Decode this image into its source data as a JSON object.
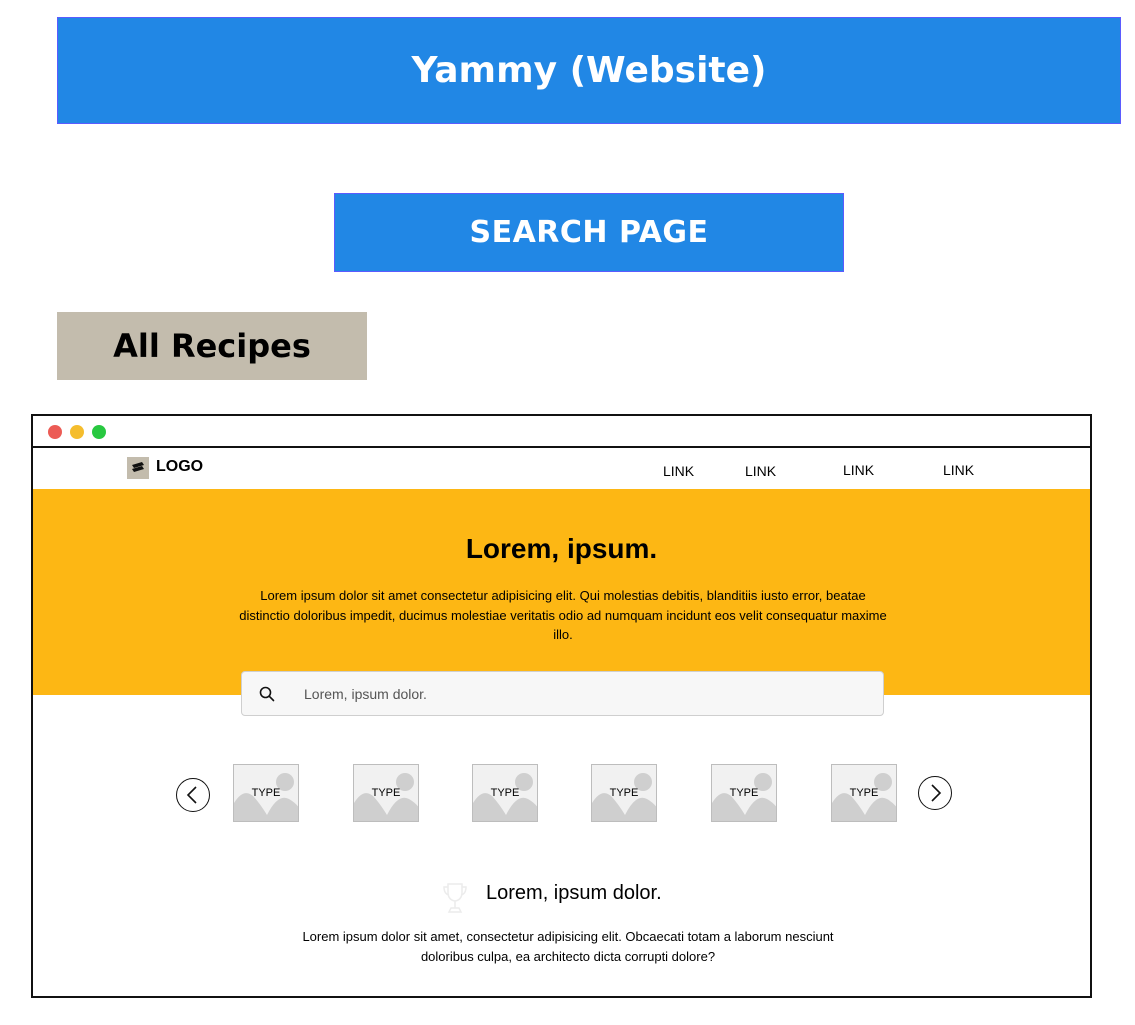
{
  "header": {
    "title": "Yammy (Website)",
    "page_label": "SEARCH PAGE",
    "section_label": "All Recipes"
  },
  "colors": {
    "banner_blue": "#2187e5",
    "section_tan": "#c3bcad",
    "hero_yellow": "#fdb714",
    "mac_red": "#ec5b55",
    "mac_yellow": "#f5bd2d",
    "mac_green": "#28c840"
  },
  "browser": {
    "nav": {
      "logo_text": "LOGO",
      "links": [
        "LINK",
        "LINK",
        "LINK",
        "LINK"
      ]
    },
    "hero": {
      "title": "Lorem, ipsum.",
      "text": "Lorem ipsum dolor sit amet consectetur adipisicing elit. Qui molestias debitis, blanditiis iusto error, beatae distinctio doloribus impedit, ducimus molestiae veritatis odio ad numquam incidunt eos velit consequatur maxime illo.",
      "search_placeholder": "Lorem, ipsum dolor."
    },
    "carousel": {
      "cards": [
        "TYPE",
        "TYPE",
        "TYPE",
        "TYPE",
        "TYPE",
        "TYPE"
      ]
    },
    "feature": {
      "icon": "trophy-icon",
      "title": "Lorem, ipsum dolor.",
      "text": "Lorem ipsum dolor sit amet, consectetur adipisicing elit. Obcaecati totam a laborum nesciunt doloribus culpa, ea architecto dicta corrupti dolore?"
    }
  }
}
